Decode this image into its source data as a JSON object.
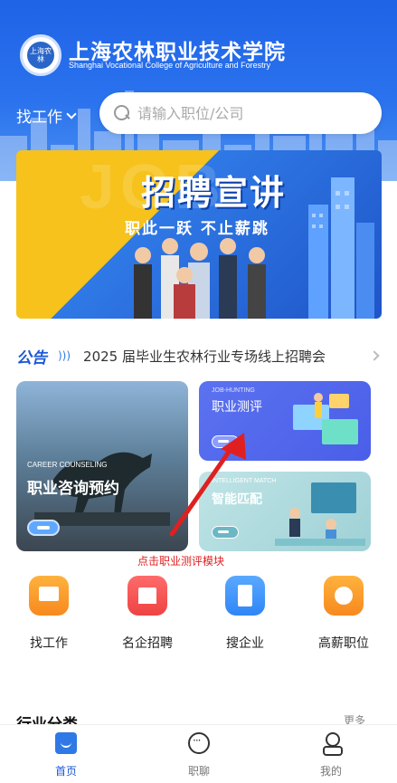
{
  "header": {
    "school_cn": "上海农林职业技术学院",
    "school_en": "Shanghai Vocational College of Agriculture and Forestry",
    "logo_text": "上海农林",
    "job_selector": "找工作",
    "search_placeholder": "请输入职位/公司",
    "bg_color": "#2a72ee"
  },
  "banner": {
    "bg_text": "JOB",
    "title": "招聘宣讲",
    "subtitle": "职此一跃 不止薪跳"
  },
  "notice": {
    "tag": "公告",
    "text": "2025 届毕业生农林行业专场线上招聘会"
  },
  "cards": {
    "left": {
      "en": "CAREER COUNSELING",
      "cn": "职业咨询预约"
    },
    "top_right": {
      "en": "JOB-HUNTING",
      "cn": "职业测评"
    },
    "bottom_right": {
      "en": "INTELLIGENT MATCH",
      "cn": "智能匹配"
    }
  },
  "annotation": {
    "text": "点击职业测评模块",
    "color": "#e02020"
  },
  "quick_actions": [
    {
      "label": "找工作",
      "icon": "monitor-icon"
    },
    {
      "label": "名企招聘",
      "icon": "building-icon"
    },
    {
      "label": "搜企业",
      "icon": "document-icon"
    },
    {
      "label": "高薪职位",
      "icon": "medal-icon"
    }
  ],
  "section": {
    "title": "行业分类",
    "more": "更多"
  },
  "tabbar": [
    {
      "label": "首页",
      "icon": "home-icon",
      "active": true
    },
    {
      "label": "职聊",
      "icon": "chat-icon",
      "active": false
    },
    {
      "label": "我的",
      "icon": "profile-icon",
      "active": false
    }
  ],
  "accent_color": "#1b57d6"
}
